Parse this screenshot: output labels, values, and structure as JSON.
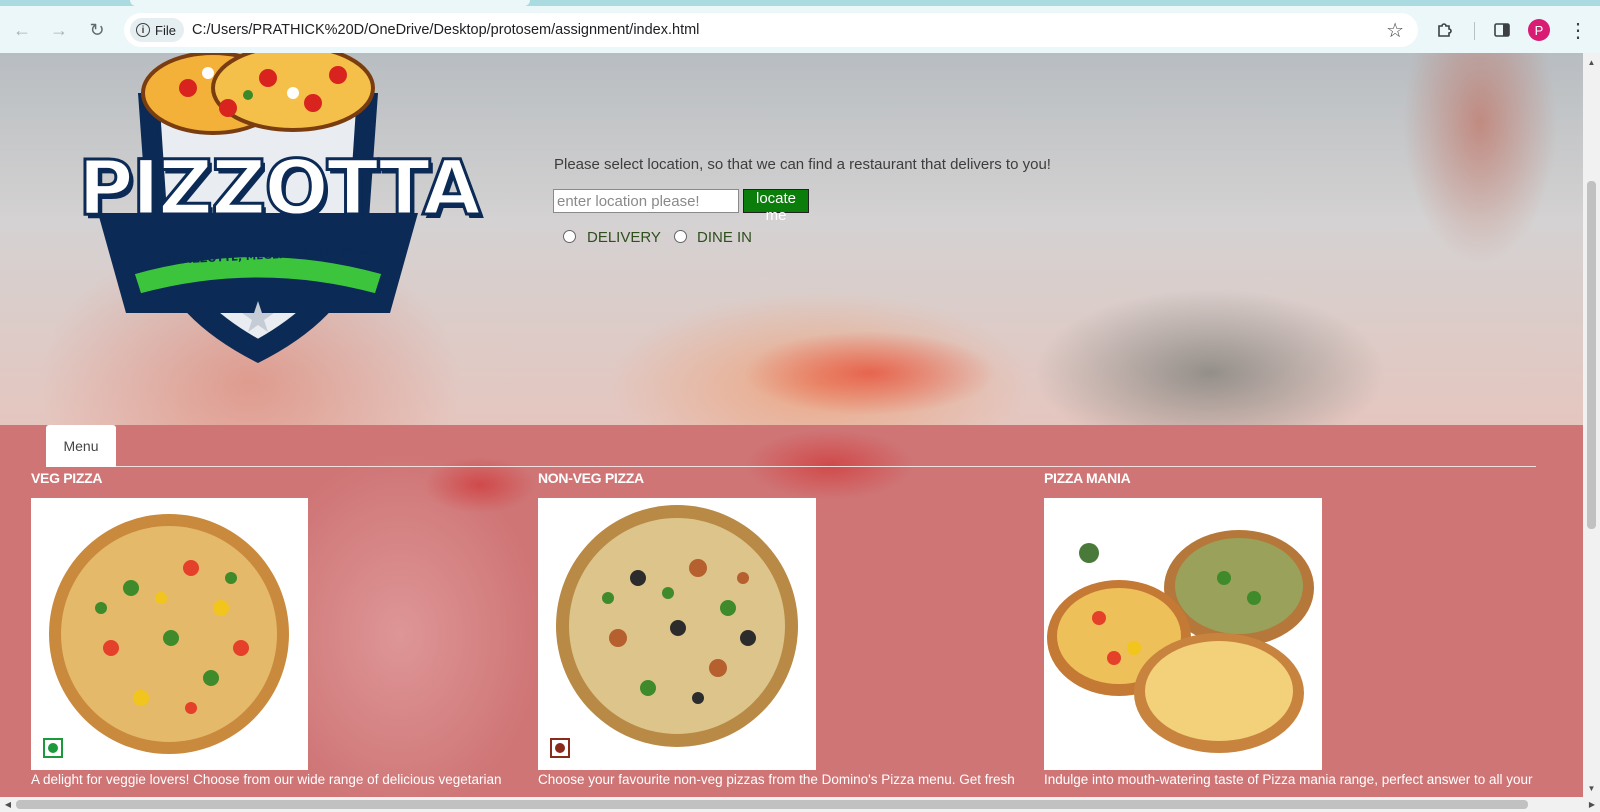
{
  "browser": {
    "chip_label": "File",
    "url": "C:/Users/PRATHICK%20D/OneDrive/Desktop/protosem/assignment/index.html",
    "profile_initial": "P",
    "icons": [
      "back-icon",
      "forward-icon",
      "reload-icon",
      "info-icon",
      "star-icon",
      "extensions-icon",
      "side-panel-icon",
      "kebab-menu-icon"
    ]
  },
  "brand": {
    "name": "PIZZOTTA",
    "tagline": "DUE PIZZOTTE, MEGLIO DI UNA PIZZA"
  },
  "location": {
    "prompt": "Please select location, so that we can find a restaurant that delivers to you!",
    "placeholder": "enter location please!",
    "button_label": "locate me",
    "options": [
      "DELIVERY",
      "DINE IN"
    ]
  },
  "menu": {
    "tab_label": "Menu",
    "categories": [
      {
        "title": "VEG PIZZA",
        "description": "A delight for veggie lovers! Choose from our wide range of delicious vegetarian",
        "badge": "veg"
      },
      {
        "title": "NON-VEG PIZZA",
        "description": "Choose your favourite non-veg pizzas from the Domino's Pizza menu. Get fresh",
        "badge": "non-veg"
      },
      {
        "title": "PIZZA MANIA",
        "description": "Indulge into mouth-watering taste of Pizza mania range, perfect answer to all your",
        "badge": ""
      }
    ]
  },
  "colors": {
    "locate_button": "#0b7d0b",
    "menu_overlay": "#cf7576",
    "brand_navy": "#0b2a55",
    "brand_green": "#3cc43c"
  }
}
